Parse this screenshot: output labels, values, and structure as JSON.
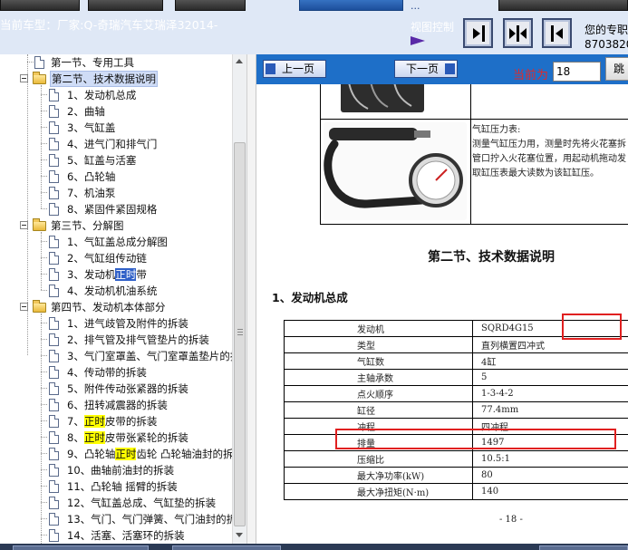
{
  "header": {
    "car_model": "当前车型：厂家:Q-奇瑞汽车艾瑞泽32014-",
    "view_control_label": "视图控制",
    "dots": "...",
    "hint_line1": "您的专职",
    "hint_line2": "8703820"
  },
  "tree": {
    "rows": [
      {
        "text": "第一节、专用工具"
      },
      {
        "text": "第二节、技术数据说明"
      },
      {
        "text": "1、发动机总成"
      },
      {
        "text": "2、曲轴"
      },
      {
        "text": "3、气缸盖"
      },
      {
        "text": "4、进气门和排气门"
      },
      {
        "text": "5、缸盖与活塞"
      },
      {
        "text": "6、凸轮轴"
      },
      {
        "text": "7、机油泵"
      },
      {
        "text": "8、紧固件紧固规格"
      },
      {
        "text": "第三节、分解图"
      },
      {
        "text": "1、气缸盖总成分解图"
      },
      {
        "text": "2、气缸组传动链"
      },
      {
        "pre": "3、发动机",
        "hl": "正时",
        "post": "带"
      },
      {
        "text": "4、发动机机油系统"
      },
      {
        "text": "第四节、发动机本体部分"
      },
      {
        "text": "1、进气歧管及附件的拆装"
      },
      {
        "text": "2、排气管及排气管垫片的拆装"
      },
      {
        "text": "3、气门室罩盖、气门室罩盖垫片的拆"
      },
      {
        "text": "4、传动带的拆装"
      },
      {
        "text": "5、附件传动张紧器的拆装"
      },
      {
        "text": "6、扭转减震器的拆装"
      },
      {
        "pre": "7、",
        "hl": "正时",
        "post": "皮带的拆装"
      },
      {
        "pre": "8、",
        "hl": "正时",
        "post": "皮带张紧轮的拆装"
      },
      {
        "pre": "9、凸轮轴",
        "hl": "正时",
        "post": "齿轮 凸轮轴油封的拆装"
      },
      {
        "text": "10、曲轴前油封的拆装"
      },
      {
        "text": "11、凸轮轴 摇臂的拆装"
      },
      {
        "text": "12、气缸盖总成、气缸垫的拆装"
      },
      {
        "text": "13、气门、气门弹簧、气门油封的拆"
      },
      {
        "text": "14、活塞、活塞环的拆装"
      }
    ]
  },
  "nav": {
    "prev_label": "上一页",
    "next_label": "下一页",
    "current_label": "当前为",
    "current_page": "18",
    "jump_label": "跳"
  },
  "doc": {
    "tool_desc": [
      "气缸压力表:",
      "测量气缸压力用，测量时先将火花塞拆",
      "管口拧入火花塞位置，用起动机拖动发",
      "取缸压表最大读数为该缸缸压。"
    ],
    "section_title": "第二节、技术数据说明",
    "subsection_title": "1、发动机总成",
    "spec_rows": [
      {
        "key": "发动机",
        "value": "SQRD4G15"
      },
      {
        "key": "类型",
        "value": "直列横置四冲式"
      },
      {
        "key": "气缸数",
        "value": "4缸"
      },
      {
        "key": "主轴承数",
        "value": "5"
      },
      {
        "key": "点火顺序",
        "value": "1-3-4-2"
      },
      {
        "key": "缸径",
        "value": "77.4mm"
      },
      {
        "key": "冲程",
        "value": "四冲程"
      },
      {
        "key": "排量",
        "value": "1497"
      },
      {
        "key": "压缩比",
        "value": "10.5:1"
      },
      {
        "key": "最大净功率(kW)",
        "value": "80"
      },
      {
        "key": "最大净扭矩(N·m)",
        "value": "140"
      }
    ],
    "page_number": "- 18 -"
  }
}
